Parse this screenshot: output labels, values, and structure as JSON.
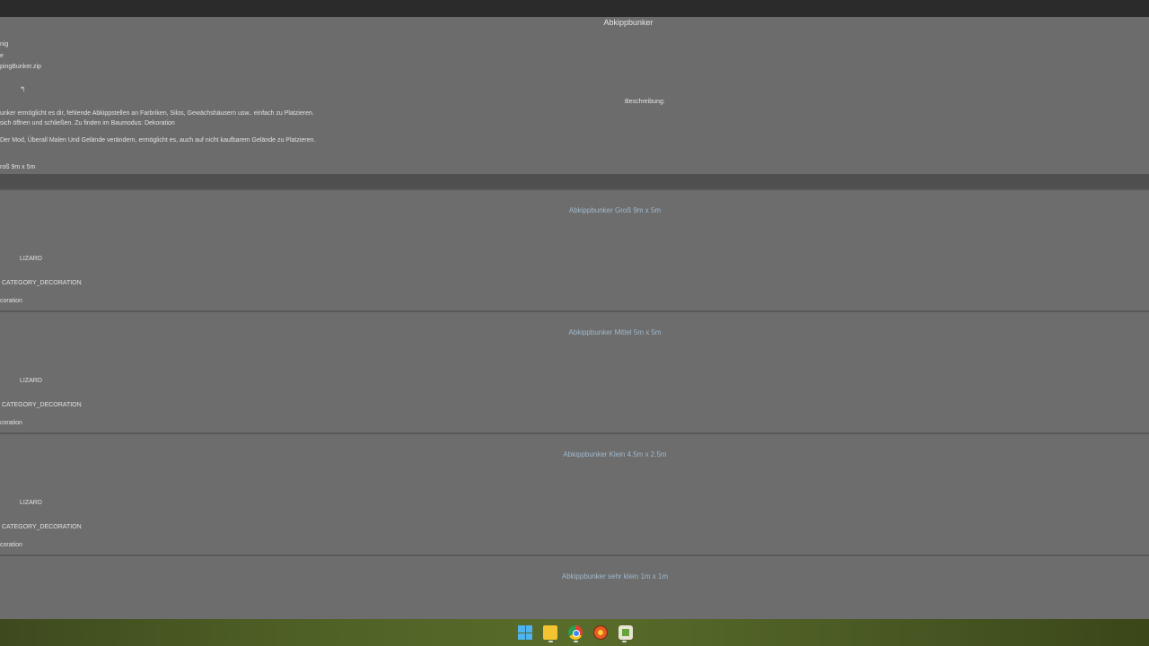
{
  "mod": {
    "title": "Abkippbunker",
    "info_lines": [
      "nig",
      "e",
      "pingBunker.zip"
    ],
    "description_label": "Beschreibung:",
    "description_lines": [
      "unker ermöglicht es dir, fehlende Abkippstellen an Farbriken, Silos, Gewächshäusern usw.. einfach zu Platzieren.",
      " sich öffnen und schließen. Zu finden im Baumodus: Dekoration",
      "Der Mod, Überall Malen Und Gelände verändern, ermöglicht es, auch auf nicht kaufbarem Gelände zu Platzieren.",
      "roß 9m x 5m"
    ],
    "icon_glyph": "↰"
  },
  "items": [
    {
      "title": "Abkippbunker Groß 9m x 5m",
      "author": "LIZARD",
      "category": "CATEGORY_DECORATION",
      "subcategory": "coration"
    },
    {
      "title": "Abkippbunker Mittel 5m x 5m",
      "author": "LIZARD",
      "category": "CATEGORY_DECORATION",
      "subcategory": "coration"
    },
    {
      "title": "Abkippbunker Klein 4.5m x 2.5m",
      "author": "LIZARD",
      "category": "CATEGORY_DECORATION",
      "subcategory": "coration"
    },
    {
      "title": "Abkippbunker sehr klein 1m x 1m"
    }
  ],
  "taskbar": {
    "icons": [
      "windows-start-icon",
      "file-explorer-icon",
      "chrome-icon",
      "browser-icon",
      "game-app-icon"
    ]
  }
}
